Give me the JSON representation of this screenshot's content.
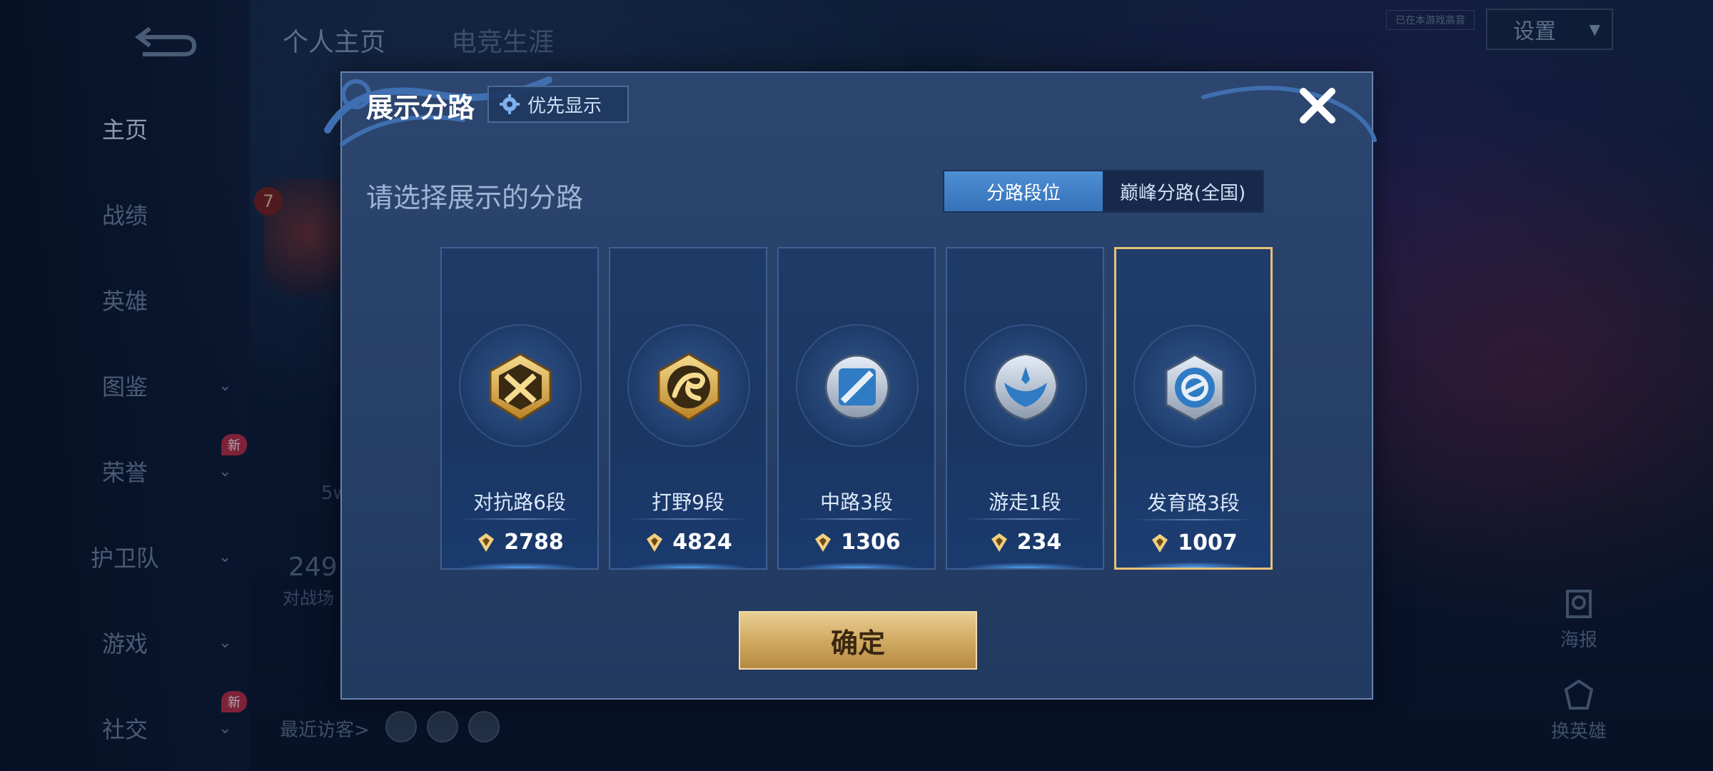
{
  "background": {
    "sidebar_items": [
      {
        "label": "主页",
        "chevron": false,
        "new": false,
        "active": true
      },
      {
        "label": "战绩",
        "chevron": false,
        "new": false,
        "active": false
      },
      {
        "label": "英雄",
        "chevron": false,
        "new": false,
        "active": false
      },
      {
        "label": "图鉴",
        "chevron": true,
        "new": false,
        "active": false
      },
      {
        "label": "荣誉",
        "chevron": true,
        "new": true,
        "active": false
      },
      {
        "label": "护卫队",
        "chevron": true,
        "new": false,
        "active": false
      },
      {
        "label": "游戏",
        "chevron": true,
        "new": false,
        "active": false
      },
      {
        "label": "社交",
        "chevron": true,
        "new": true,
        "active": false
      }
    ],
    "new_tag_label": "新",
    "top_tabs": [
      "个人主页",
      "电竞生涯"
    ],
    "settings_label": "设置",
    "recording_tag": "已在本游戏高音",
    "recent_visitors_label": "最近访客>",
    "stat_number": "249",
    "stat_sub": "对战场",
    "stat_5w": "5w",
    "avatar_level": "7",
    "right_actions": [
      {
        "label": "海报",
        "icon": "poster-icon"
      },
      {
        "label": "换英雄",
        "icon": "switch-hero-icon"
      }
    ]
  },
  "dialog": {
    "title": "展示分路",
    "priority_label": "优先显示",
    "prompt": "请选择展示的分路",
    "segment_tabs": [
      {
        "label": "分路段位",
        "active": true
      },
      {
        "label": "巅峰分路(全国)",
        "active": false
      }
    ],
    "lanes": [
      {
        "name": "对抗路6段",
        "score": "2788",
        "tier": "gold",
        "icon": "sword-clash-icon",
        "selected": false
      },
      {
        "name": "打野9段",
        "score": "4824",
        "tier": "gold",
        "icon": "dragon-icon",
        "selected": false
      },
      {
        "name": "中路3段",
        "score": "1306",
        "tier": "silver",
        "icon": "mid-slash-icon",
        "selected": false
      },
      {
        "name": "游走1段",
        "score": "234",
        "tier": "silver",
        "icon": "wings-icon",
        "selected": false
      },
      {
        "name": "发育路3段",
        "score": "1007",
        "tier": "silver",
        "icon": "crosshair-icon",
        "selected": true
      }
    ],
    "confirm_label": "确定"
  },
  "colors": {
    "gold": "#e7c27a",
    "accent_blue": "#3f82c8",
    "selected_border": "#e7c27a"
  }
}
